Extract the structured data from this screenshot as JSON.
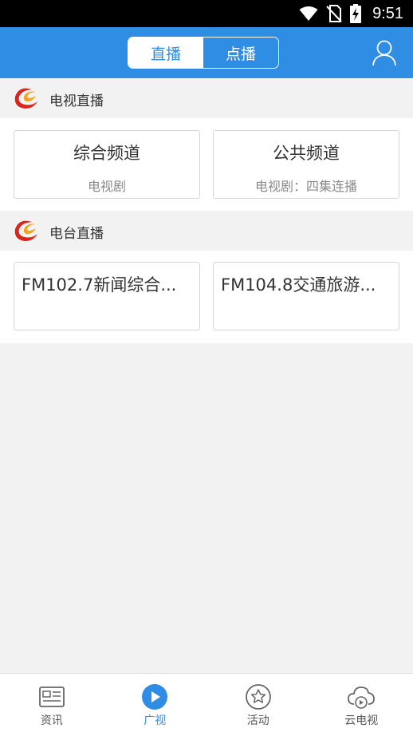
{
  "status_bar": {
    "time": "9:51"
  },
  "header": {
    "tabs": [
      {
        "label": "直播",
        "active": true
      },
      {
        "label": "点播",
        "active": false
      }
    ],
    "user_icon": "user-icon"
  },
  "sections": [
    {
      "title": "电视直播",
      "cards": [
        {
          "title": "综合频道",
          "subtitle": "电视剧"
        },
        {
          "title": "公共频道",
          "subtitle": "电视剧：四集连播"
        }
      ]
    },
    {
      "title": "电台直播",
      "cards": [
        {
          "title": "FM102.7新闻综合..."
        },
        {
          "title": "FM104.8交通旅游..."
        }
      ]
    }
  ],
  "tabbar": {
    "items": [
      {
        "label": "资讯",
        "icon": "news-icon",
        "active": false
      },
      {
        "label": "广视",
        "icon": "play-icon",
        "active": true
      },
      {
        "label": "活动",
        "icon": "star-icon",
        "active": false
      },
      {
        "label": "云电视",
        "icon": "cloud-tv-icon",
        "active": false
      }
    ]
  },
  "colors": {
    "accent": "#2f8de4",
    "background": "#f2f2f2",
    "logo_red": "#d9251c",
    "logo_orange": "#f7a21b"
  }
}
